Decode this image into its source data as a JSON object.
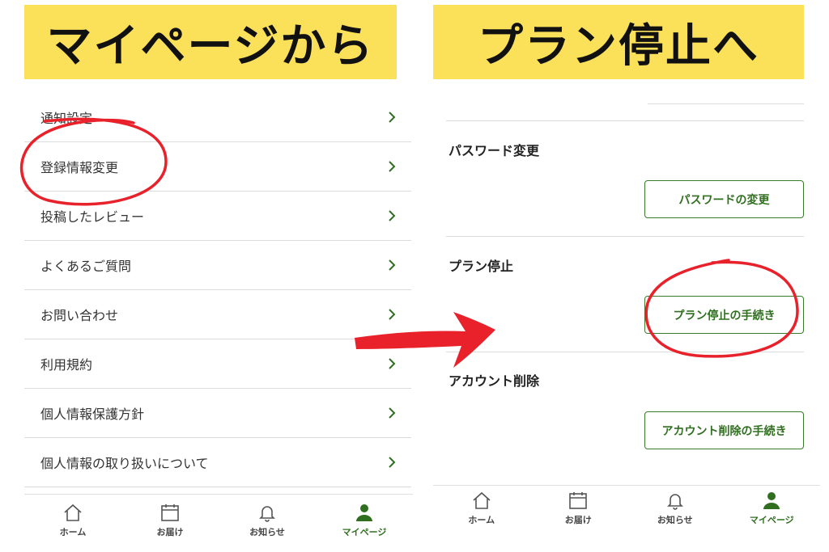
{
  "banners": {
    "left": "マイページから",
    "right": "プラン停止へ"
  },
  "menu": {
    "items": [
      {
        "label": "通知設定"
      },
      {
        "label": "登録情報変更"
      },
      {
        "label": "投稿したレビュー"
      },
      {
        "label": "よくあるご質問"
      },
      {
        "label": "お問い合わせ"
      },
      {
        "label": "利用規約"
      },
      {
        "label": "個人情報保護方針"
      },
      {
        "label": "個人情報の取り扱いについて"
      }
    ]
  },
  "settings": {
    "password": {
      "title": "パスワード変更",
      "button": "パスワードの変更"
    },
    "plan": {
      "title": "プラン停止",
      "button": "プラン停止の手続き"
    },
    "account": {
      "title": "アカウント削除",
      "button": "アカウント削除の手続き"
    }
  },
  "nav": {
    "home": "ホーム",
    "delivery": "お届け",
    "notices": "お知らせ",
    "mypage": "マイページ"
  },
  "colors": {
    "banner": "#fbe05a",
    "accent": "#2f6f1f",
    "annotation": "#e8212a"
  }
}
